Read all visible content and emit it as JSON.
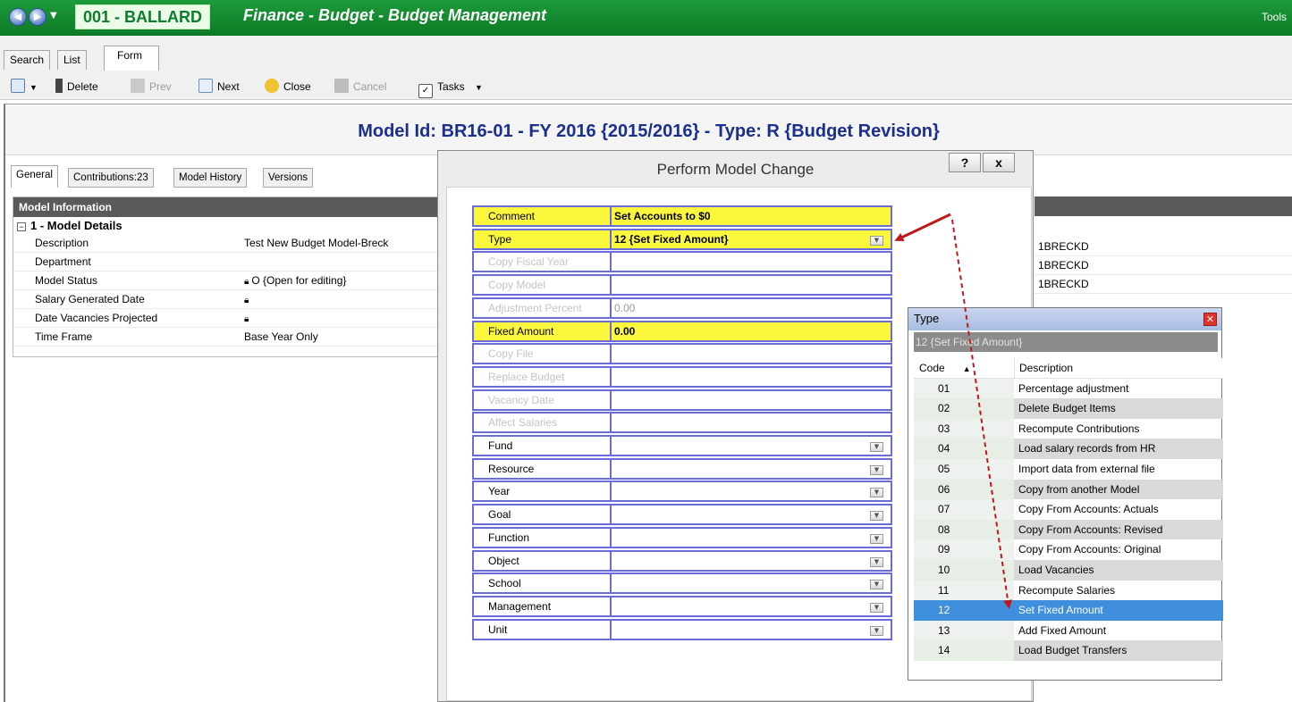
{
  "titlebar": {
    "org": "001 - BALLARD",
    "app_title": "Finance - Budget - Budget Management",
    "tools": "Tools"
  },
  "view_tabs": [
    "Search",
    "List",
    "Form"
  ],
  "toolbar": {
    "delete": "Delete",
    "prev": "Prev",
    "next": "Next",
    "close": "Close",
    "cancel": "Cancel",
    "tasks": "Tasks"
  },
  "model_header": "Model Id: BR16-01 - FY 2016 {2015/2016} - Type: R {Budget Revision}",
  "sub_tabs": [
    "General",
    "Contributions:23",
    "Model History",
    "Versions"
  ],
  "model_info": {
    "header": "Model Information",
    "group": "1 - Model Details",
    "rows": [
      {
        "label": "Description",
        "value": "Test New Budget Model-Breck",
        "locked": false
      },
      {
        "label": "Department",
        "value": "",
        "locked": false
      },
      {
        "label": "Model Status",
        "value": "O {Open for editing}",
        "locked": true
      },
      {
        "label": "Salary Generated Date",
        "value": "",
        "locked": true
      },
      {
        "label": "Date Vacancies Projected",
        "value": "",
        "locked": true
      },
      {
        "label": "Time Frame",
        "value": "Base Year Only",
        "locked": false
      }
    ]
  },
  "right_grid": {
    "values": [
      "1BRECKD",
      "1BRECKD",
      "1BRECKD"
    ]
  },
  "dialog": {
    "title": "Perform Model Change",
    "help_label": "?",
    "close_label": "x",
    "fields": [
      {
        "label": "Comment",
        "value": "Set Accounts to $0",
        "state": "highlight",
        "dropdown": false
      },
      {
        "label": "Type",
        "value": "12 {Set Fixed Amount}",
        "state": "highlight",
        "dropdown": true
      },
      {
        "label": "Copy Fiscal Year",
        "value": "",
        "state": "disabled",
        "dropdown": false
      },
      {
        "label": "Copy Model",
        "value": "",
        "state": "disabled",
        "dropdown": false
      },
      {
        "label": "Adjustment Percent",
        "value": "0.00",
        "state": "disabled",
        "dropdown": false
      },
      {
        "label": "Fixed Amount",
        "value": "0.00",
        "state": "highlight",
        "dropdown": false
      },
      {
        "label": "Copy File",
        "value": "",
        "state": "disabled",
        "dropdown": false
      },
      {
        "label": "Replace Budget",
        "value": "",
        "state": "disabled",
        "dropdown": false
      },
      {
        "label": "Vacancy Date",
        "value": "",
        "state": "disabled",
        "dropdown": false
      },
      {
        "label": "Affect Salaries",
        "value": "",
        "state": "disabled",
        "dropdown": false
      },
      {
        "label": "Fund",
        "value": "",
        "state": "normal",
        "dropdown": true
      },
      {
        "label": "Resource",
        "value": "",
        "state": "normal",
        "dropdown": true
      },
      {
        "label": "Year",
        "value": "",
        "state": "normal",
        "dropdown": true
      },
      {
        "label": "Goal",
        "value": "",
        "state": "normal",
        "dropdown": true
      },
      {
        "label": "Function",
        "value": "",
        "state": "normal",
        "dropdown": true
      },
      {
        "label": "Object",
        "value": "",
        "state": "normal",
        "dropdown": true
      },
      {
        "label": "School",
        "value": "",
        "state": "normal",
        "dropdown": true
      },
      {
        "label": "Management",
        "value": "",
        "state": "normal",
        "dropdown": true
      },
      {
        "label": "Unit",
        "value": "",
        "state": "normal",
        "dropdown": true
      }
    ]
  },
  "type_popup": {
    "title": "Type",
    "current": "12 {Set Fixed Amount}",
    "col_code": "Code",
    "col_desc": "Description",
    "selected_code": "12",
    "items": [
      {
        "code": "01",
        "desc": "Percentage adjustment"
      },
      {
        "code": "02",
        "desc": "Delete Budget Items"
      },
      {
        "code": "03",
        "desc": "Recompute Contributions"
      },
      {
        "code": "04",
        "desc": "Load salary records from HR"
      },
      {
        "code": "05",
        "desc": "Import data from external file"
      },
      {
        "code": "06",
        "desc": "Copy from another Model"
      },
      {
        "code": "07",
        "desc": "Copy From Accounts: Actuals"
      },
      {
        "code": "08",
        "desc": "Copy From Accounts: Revised"
      },
      {
        "code": "09",
        "desc": "Copy From Accounts: Original"
      },
      {
        "code": "10",
        "desc": "Load Vacancies"
      },
      {
        "code": "11",
        "desc": "Recompute Salaries"
      },
      {
        "code": "12",
        "desc": "Set Fixed Amount"
      },
      {
        "code": "13",
        "desc": "Add Fixed Amount"
      },
      {
        "code": "14",
        "desc": "Load Budget Transfers"
      }
    ]
  },
  "colors": {
    "title_green": "#0c7a26",
    "header_blue": "#1b2f8c",
    "highlight_yellow": "#fbf73d",
    "field_border": "#6c6cd8",
    "selection_blue": "#3f8fdc",
    "annotation_red": "#c0171b"
  }
}
